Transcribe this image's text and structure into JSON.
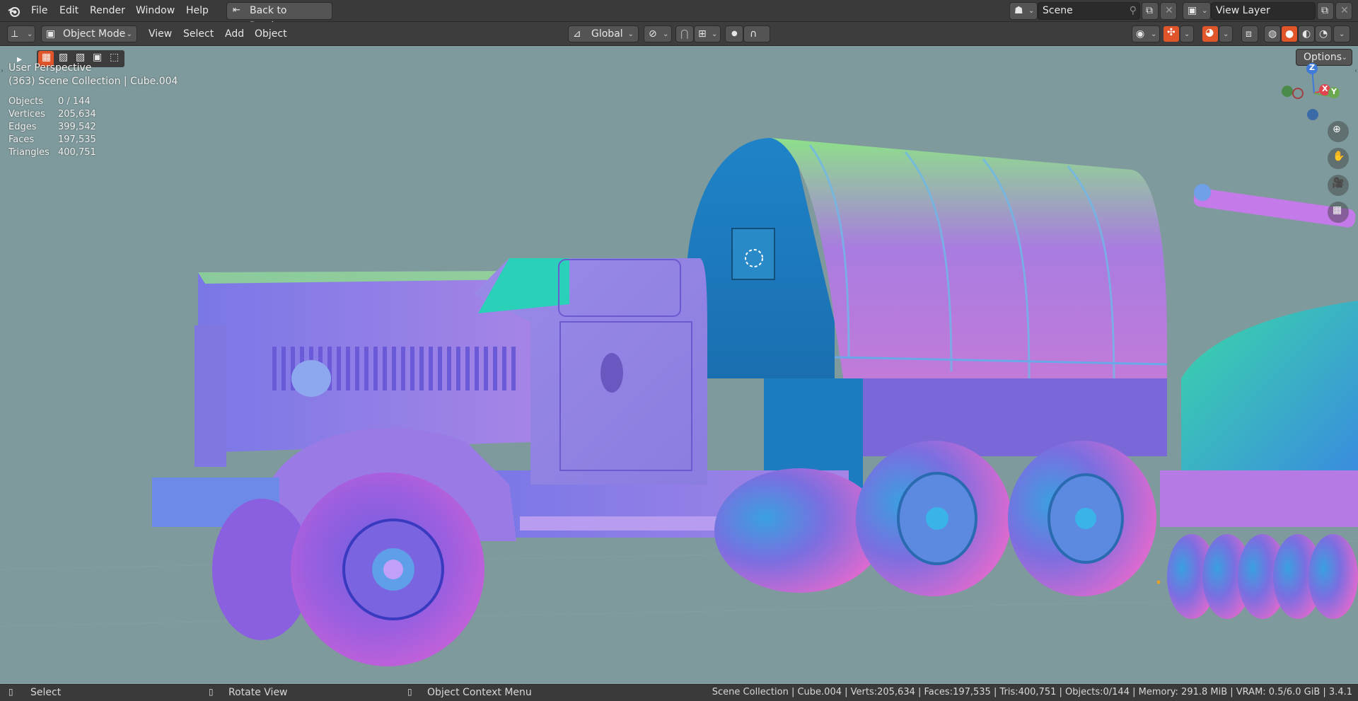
{
  "menubar": {
    "items": [
      "File",
      "Edit",
      "Render",
      "Window",
      "Help"
    ],
    "back_button": "Back to Previous",
    "scene": "Scene",
    "view_layer": "View Layer"
  },
  "header": {
    "mode": "Object Mode",
    "menus": [
      "View",
      "Select",
      "Add",
      "Object"
    ],
    "orientation": "Global",
    "options": "Options"
  },
  "viewport": {
    "view_name": "User Perspective",
    "collection": "(363) Scene Collection | Cube.004",
    "stats": [
      {
        "label": "Objects",
        "value": "0 / 144"
      },
      {
        "label": "Vertices",
        "value": "205,634"
      },
      {
        "label": "Edges",
        "value": "399,542"
      },
      {
        "label": "Faces",
        "value": "197,535"
      },
      {
        "label": "Triangles",
        "value": "400,751"
      }
    ],
    "gizmo": {
      "z": "Z",
      "x": "X",
      "y": "Y"
    }
  },
  "statusbar": {
    "select": "Select",
    "rotate": "Rotate View",
    "context": "Object Context Menu",
    "info": "Scene Collection | Cube.004 | Verts:205,634 | Faces:197,535 | Tris:400,751 | Objects:0/144 | Memory: 291.8 MiB | VRAM: 0.5/6.0 GiB | 3.4.1"
  },
  "colors": {
    "accent_orange": "#e0552a",
    "header_bg": "#3d3d3d",
    "viewport_bg": "#7f9a9c",
    "axis_x": "#e0454f",
    "axis_y": "#6aa84f",
    "axis_z": "#3f7ad9"
  }
}
